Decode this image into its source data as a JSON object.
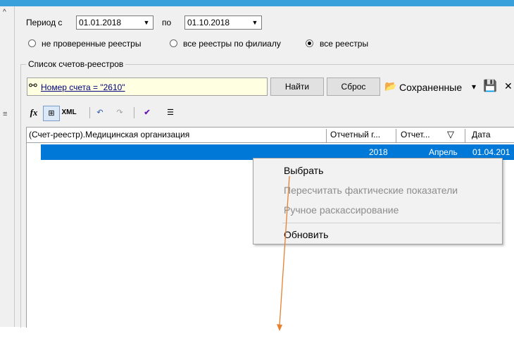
{
  "period": {
    "from_label": "Период с",
    "from_value": "01.01.2018",
    "to_label": "по",
    "to_value": "01.10.2018"
  },
  "filters": {
    "radio1": "не проверенные реестры",
    "radio2": "все реестры по филиалу",
    "radio3": "все реестры",
    "selected": "все реестры"
  },
  "group_title": "Список счетов-реестров",
  "search": {
    "filter_text": "Номер счета = \"2610\"",
    "find_label": "Найти",
    "reset_label": "Сброс",
    "saved_label": "Сохраненные",
    "saved_arrow": "▾",
    "close_glyph": "✕"
  },
  "toolbar2": {
    "fx_label": "fx",
    "xml_label": "XML"
  },
  "grid": {
    "columns": [
      "(Счет-реестр).Медицинская организация",
      "Отчетный г...",
      "Отчет...",
      "Дата"
    ],
    "rows": [
      {
        "org": "",
        "year": "2018",
        "month": "Апрель",
        "date": "01.04.201"
      }
    ]
  },
  "context_menu": {
    "items": [
      "Выбрать",
      "Пересчитать фактические показатели",
      "Ручное раскассирование",
      "Обновить"
    ],
    "disabled": [
      "Пересчитать фактические показатели",
      "Ручное раскассирование"
    ]
  },
  "colors": {
    "accent": "#0078d7",
    "annotation_arrow": "#e6812f",
    "filter_bg": "#ffffe1"
  }
}
